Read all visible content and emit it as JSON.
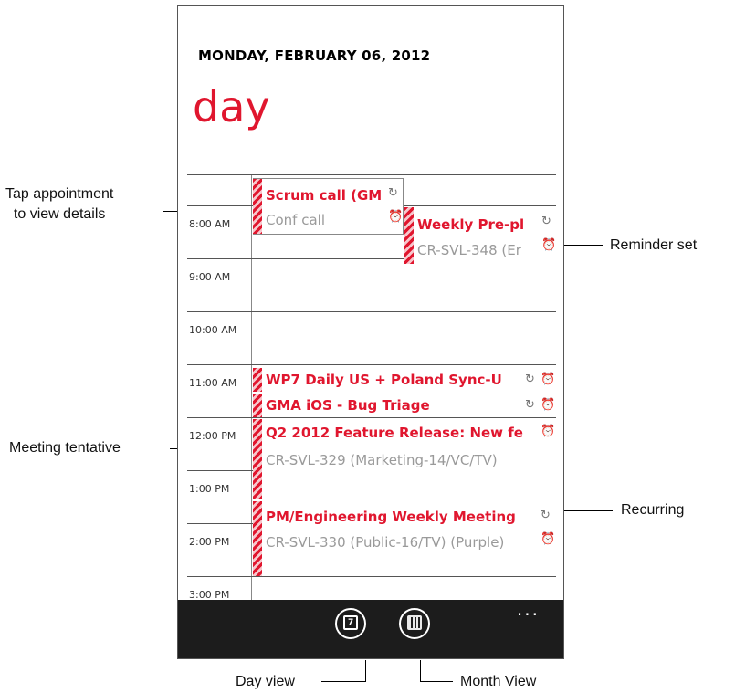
{
  "header": {
    "date": "MONDAY, FEBRUARY 06, 2012",
    "pivot_title": "day"
  },
  "hours": [
    "8:00 AM",
    "9:00 AM",
    "10:00 AM",
    "11:00 AM",
    "12:00 PM",
    "1:00 PM",
    "2:00 PM",
    "3:00 PM"
  ],
  "appointments": [
    {
      "title": "Scrum call (GM",
      "location": "Conf call",
      "recurring": true,
      "reminder": true,
      "status": "tentative"
    },
    {
      "title": "Weekly Pre-pl",
      "location": "CR-SVL-348 (Er",
      "recurring": true,
      "reminder": true,
      "status": "tentative"
    },
    {
      "title": "WP7 Daily US + Poland Sync-U",
      "location": "",
      "recurring": true,
      "reminder": true,
      "status": "tentative"
    },
    {
      "title": "GMA iOS - Bug Triage",
      "location": "",
      "recurring": true,
      "reminder": true,
      "status": "tentative"
    },
    {
      "title": "Q2 2012 Feature Release: New fe",
      "location": "CR-SVL-329 (Marketing-14/VC/TV)",
      "recurring": false,
      "reminder": true,
      "status": "tentative"
    },
    {
      "title": "PM/Engineering Weekly Meeting",
      "location": "CR-SVL-330 (Public-16/TV) (Purple)",
      "recurring": true,
      "reminder": true,
      "status": "tentative"
    }
  ],
  "appbar": {
    "buttons": [
      {
        "icon": "calendar-day-icon"
      },
      {
        "icon": "calendar-month-icon"
      }
    ],
    "more": "..."
  },
  "callouts": {
    "tap": "Tap appointment\nto view details",
    "reminder": "Reminder set",
    "tentative": "Meeting tentative",
    "recurring": "Recurring",
    "day_view": "Day view",
    "month_view": "Month View"
  },
  "icons": {
    "recurring": "recurring-icon",
    "reminder": "alarm-clock-icon"
  },
  "colors": {
    "accent": "#e0162e",
    "appbar": "#1c1c1c",
    "secondary_text": "#9a9a9a"
  }
}
